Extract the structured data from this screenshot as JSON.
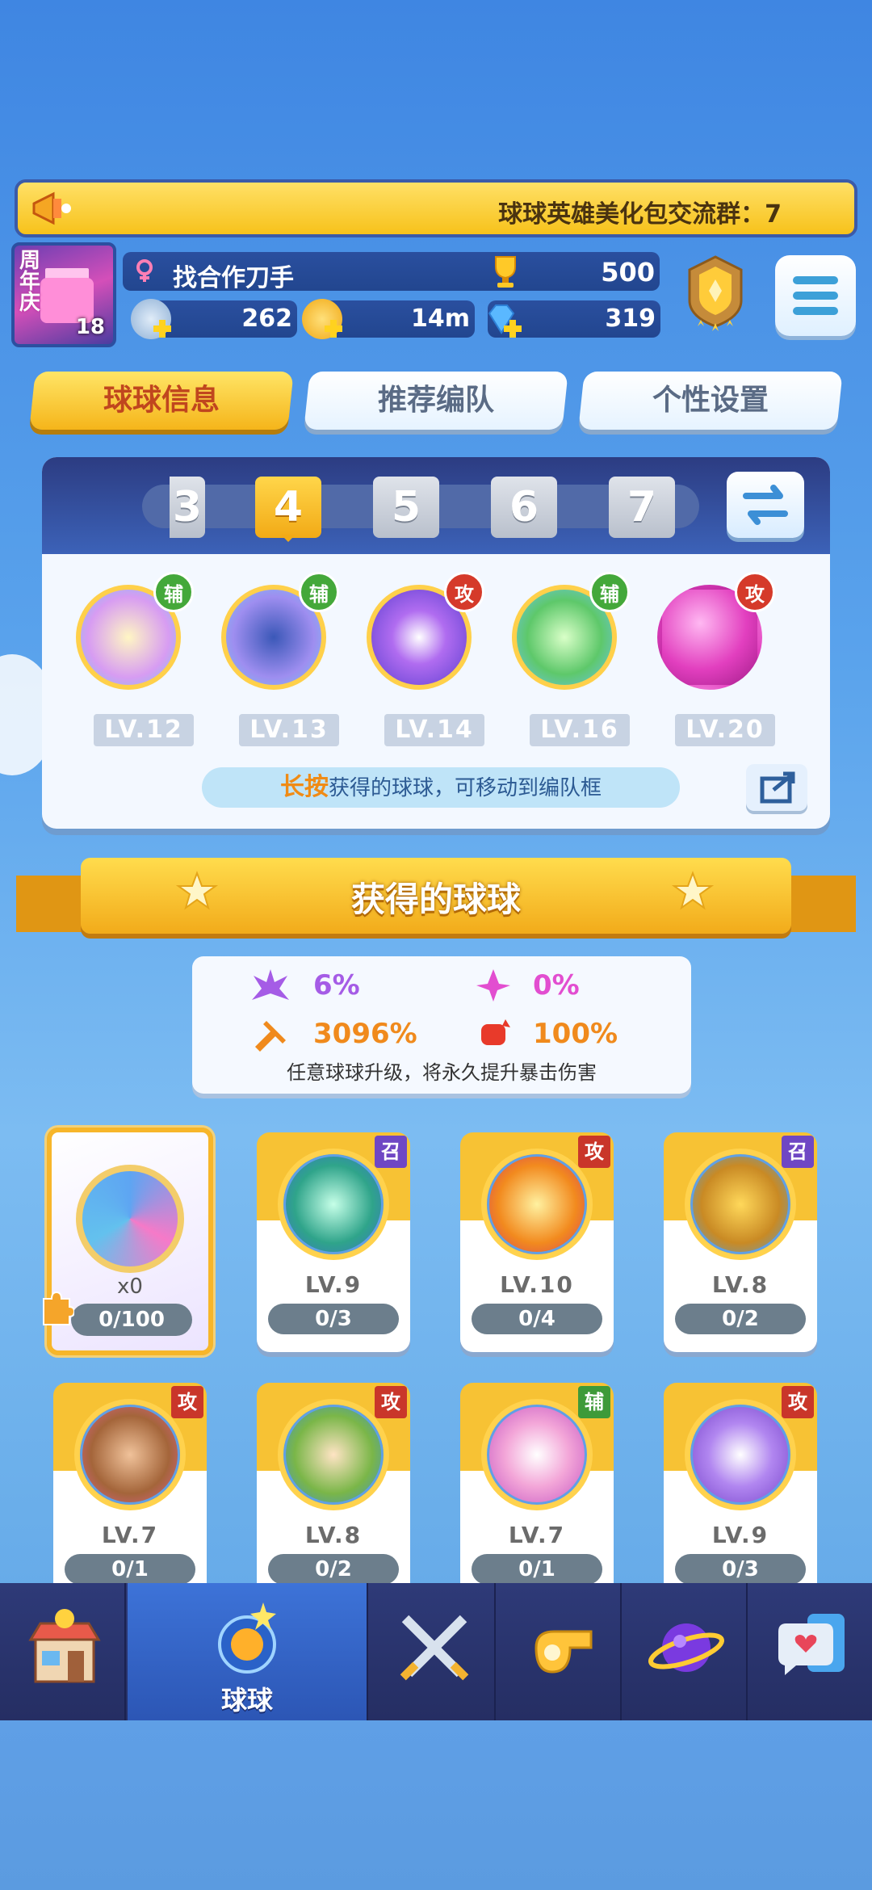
{
  "banner": {
    "text": "球球英雄美化包交流群：7"
  },
  "profile": {
    "avatar_label": "周年庆",
    "level": "18",
    "name": "找合作刀手",
    "trophies": "500",
    "resources": [
      "262",
      "14m",
      "319"
    ]
  },
  "tabs": [
    "球球信息",
    "推荐编队",
    "个性设置"
  ],
  "team": {
    "slots": [
      "3",
      "4",
      "5",
      "6",
      "7"
    ],
    "active_slot": "4",
    "balls": [
      {
        "tag": "辅",
        "level": "LV.12"
      },
      {
        "tag": "辅",
        "level": "LV.13"
      },
      {
        "tag": "攻",
        "level": "LV.14"
      },
      {
        "tag": "辅",
        "level": "LV.16"
      },
      {
        "tag": "攻",
        "level": "LV.20"
      }
    ],
    "hint_strong": "长按",
    "hint_rest": "获得的球球，可移动到编队框"
  },
  "section_title": "获得的球球",
  "stats": {
    "values": [
      "6%",
      "0%",
      "3096%",
      "100%"
    ],
    "note": "任意球球升级，将永久提升暴击伤害"
  },
  "special_card": {
    "count": "x0",
    "progress": "0/100"
  },
  "cards": [
    {
      "tag": "召",
      "level": "LV.9",
      "progress": "0/3"
    },
    {
      "tag": "攻",
      "level": "LV.10",
      "progress": "0/4"
    },
    {
      "tag": "召",
      "level": "LV.8",
      "progress": "0/2"
    },
    {
      "tag": "攻",
      "level": "LV.7",
      "progress": "0/1"
    },
    {
      "tag": "攻",
      "level": "LV.8",
      "progress": "0/2"
    },
    {
      "tag": "辅",
      "level": "LV.7",
      "progress": "0/1"
    },
    {
      "tag": "攻",
      "level": "LV.9",
      "progress": "0/3"
    }
  ],
  "nav": {
    "active_label": "球球"
  },
  "colors": {
    "gold": "#f7c234",
    "navy": "#2e3a78",
    "attack_red": "#c9362a",
    "assist_green": "#3e9a39",
    "summon_purple": "#6f47c4"
  }
}
